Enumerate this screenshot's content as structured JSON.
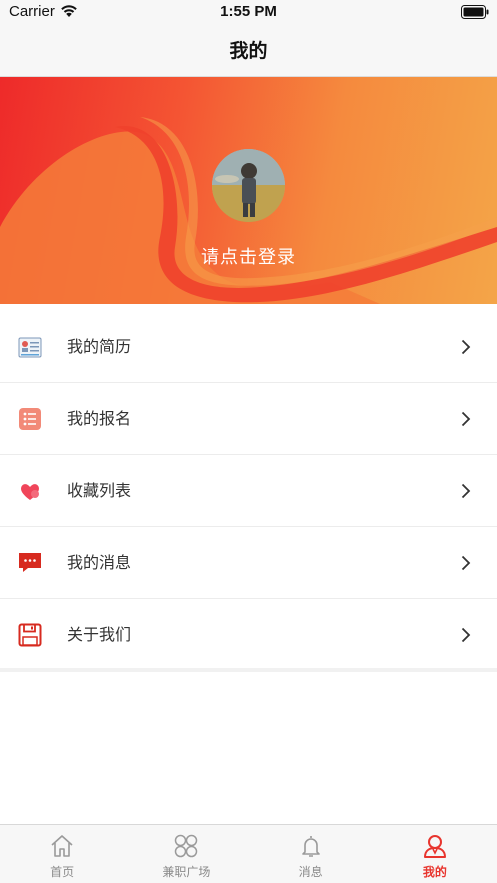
{
  "status_bar": {
    "carrier": "Carrier",
    "time": "1:55 PM"
  },
  "nav": {
    "title": "我的"
  },
  "profile": {
    "login_prompt": "请点击登录"
  },
  "menu": [
    {
      "label": "我的简历",
      "icon": "resume-icon"
    },
    {
      "label": "我的报名",
      "icon": "list-icon"
    },
    {
      "label": "收藏列表",
      "icon": "heart-icon"
    },
    {
      "label": "我的消息",
      "icon": "chat-icon"
    },
    {
      "label": "关于我们",
      "icon": "save-icon"
    }
  ],
  "tabs": [
    {
      "label": "首页",
      "icon": "home-icon",
      "active": false
    },
    {
      "label": "兼职广场",
      "icon": "grid-icon",
      "active": false
    },
    {
      "label": "消息",
      "icon": "bell-icon",
      "active": false
    },
    {
      "label": "我的",
      "icon": "user-icon",
      "active": true
    }
  ],
  "colors": {
    "accent": "#e8352e",
    "banner_start": "#ee2a2a",
    "banner_end": "#f4a548"
  }
}
